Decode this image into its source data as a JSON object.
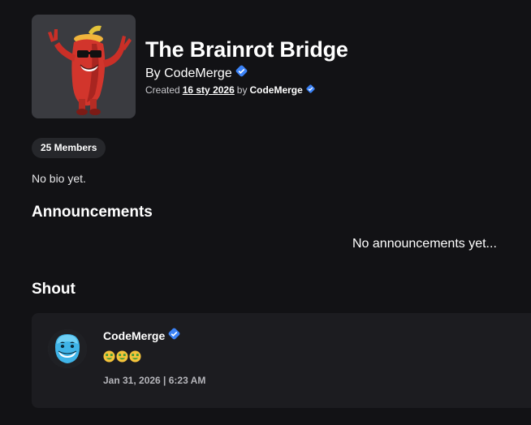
{
  "group": {
    "title": "The Brainrot Bridge",
    "byline": "By CodeMerge",
    "created_prefix": "Created",
    "created_date": "16 sty 2026",
    "created_by_word": "by",
    "owner": "CodeMerge",
    "members_label": "25 Members",
    "bio": "No bio yet."
  },
  "announcements": {
    "heading": "Announcements",
    "empty_text": "No announcements yet..."
  },
  "shout": {
    "heading": "Shout",
    "author": "CodeMerge",
    "message_emojis": [
      "money-mouth-face-emoji",
      "money-mouth-face-emoji",
      "money-mouth-face-emoji"
    ],
    "timestamp": "Jan 31, 2026 | 6:23 AM"
  },
  "colors": {
    "background": "#121215",
    "card": "#1c1c20",
    "pill": "#26272b",
    "verified_badge": "#3b82f6",
    "muted_text": "#b5b5ba"
  },
  "icons": {
    "verified": "verified-badge-icon",
    "group_icon": "red-chili-pepper-character-with-sunglasses",
    "avatar": "blue-smiling-avatar-head"
  }
}
